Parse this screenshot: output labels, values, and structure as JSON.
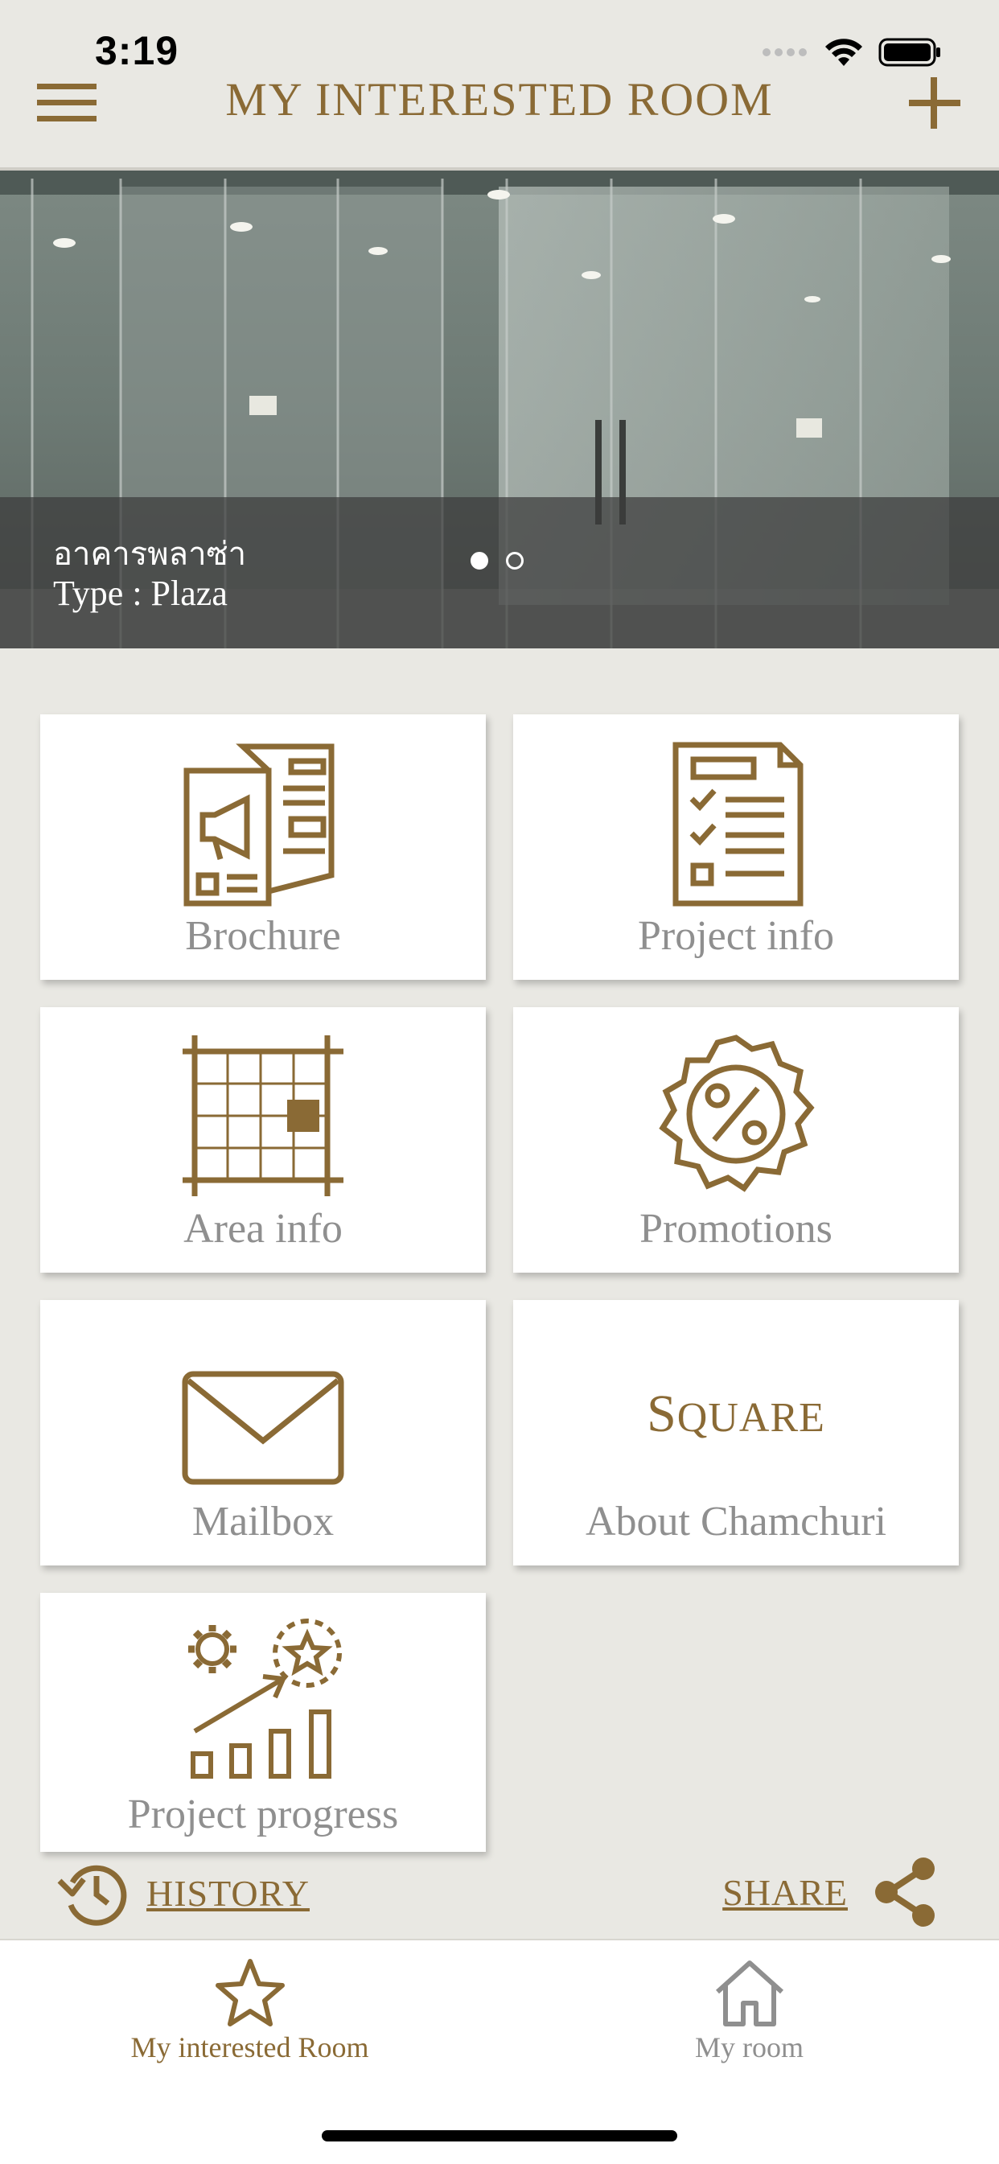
{
  "status_bar": {
    "time": "3:19"
  },
  "header": {
    "title": "MY INTERESTED ROOM",
    "menu_icon": "hamburger-menu-icon",
    "add_icon": "plus-icon"
  },
  "hero": {
    "name": "อาคารพลาซ่า",
    "type_text": "Type : Plaza",
    "slide_count": 2,
    "active_slide": 1
  },
  "tiles": {
    "brochure": {
      "label": "Brochure",
      "icon": "brochure-icon"
    },
    "project_info": {
      "label": "Project info",
      "icon": "checklist-icon"
    },
    "area_info": {
      "label": "Area info",
      "icon": "floor-grid-icon"
    },
    "promotions": {
      "label": "Promotions",
      "icon": "percent-badge-icon"
    },
    "mailbox": {
      "label": "Mailbox",
      "icon": "envelope-icon"
    },
    "about": {
      "label": "About Chamchuri",
      "logo_text": "Square"
    },
    "project_progress": {
      "label": "Project progress",
      "icon": "progress-chart-icon"
    }
  },
  "actions": {
    "history_label": "HISTORY",
    "share_label": "SHARE"
  },
  "tabbar": {
    "tabs": [
      {
        "label": "My interested Room",
        "icon": "star-icon",
        "active": true
      },
      {
        "label": "My room",
        "icon": "home-icon",
        "active": false
      }
    ]
  },
  "colors": {
    "accent": "#8a6a35",
    "background": "#e9e8e3",
    "tile_label": "#8f8f8f",
    "inactive": "#8f8f8f"
  }
}
